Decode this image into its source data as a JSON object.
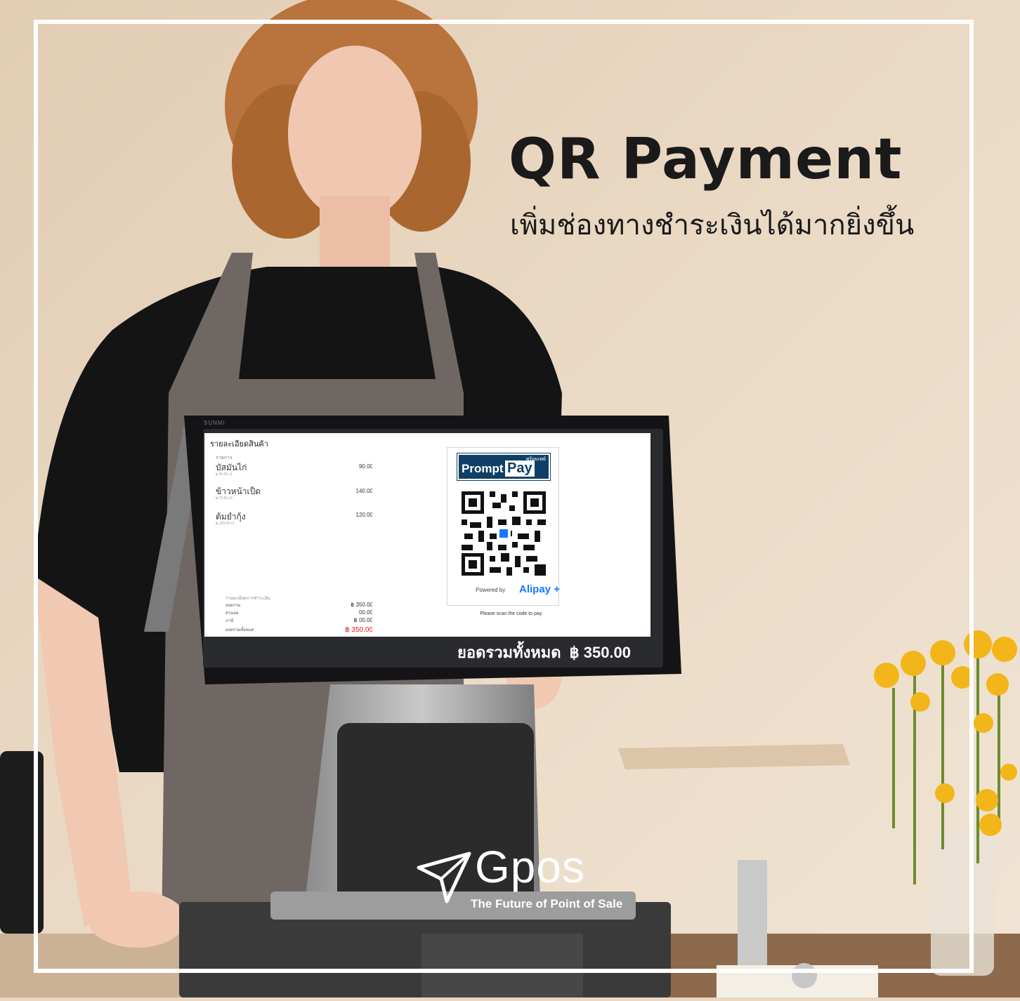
{
  "headline": "QR Payment",
  "subheadline": "เพิ่มช่องทางชำระเงินได้มากยิ่งขึ้น",
  "pos": {
    "brand": "SUNMI",
    "receipt": {
      "title": "รายละเอียดสินค้า",
      "section_label": "รายการ",
      "items": [
        {
          "name": "บัสมันไก่",
          "sub": "฿ 90.00 x1",
          "price": "90.00"
        },
        {
          "name": "ข้าวหน้าเป็ด",
          "sub": "฿ 70.00 x2",
          "price": "140.00"
        },
        {
          "name": "ต้มยำกุ้ง",
          "sub": "฿ 120.00 x1",
          "price": "120.00"
        }
      ],
      "summary_heading": "รายละเอียดการชำระเงิน",
      "summary": [
        {
          "label": "ยอดรวม",
          "value": "฿ 350.00"
        },
        {
          "label": "ส่วนลด",
          "value": "00.00"
        },
        {
          "label": "ภาษี",
          "value": "฿ 00.00"
        },
        {
          "label": "ยอดรวมทั้งหมด",
          "value": "฿ 350.00"
        }
      ]
    },
    "qr_panel": {
      "promptpay_left": "Prompt",
      "promptpay_right": "Pay",
      "promptpay_thai": "พร้อมเพย์",
      "powered_by": "Powered by",
      "alipay": "Alipay",
      "alipay_mark": "+",
      "scan_note": "Please scan the code to pay."
    },
    "total_label": "ยอดรวมทั้งหมด",
    "total_amount": "฿ 350.00"
  },
  "brand": {
    "name": "Gpos",
    "tagline": "The Future of Point of Sale",
    "logo_icon": "paper-plane-icon"
  },
  "colors": {
    "background": "#e9d7c2",
    "headline": "#1a1a1a",
    "frame": "#ffffff",
    "promptpay_blue": "#0f3f66",
    "alipay_blue": "#1677ff",
    "total_red": "#e02020"
  }
}
